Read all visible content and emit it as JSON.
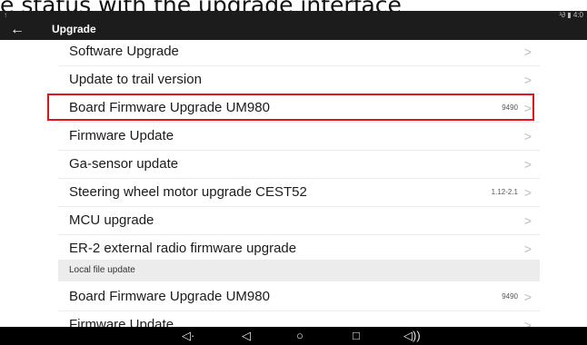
{
  "caption": "e status with the upgrade interface",
  "status_bar": {
    "left": "↑",
    "right": "³∂ ▮ 4:0"
  },
  "app_bar": {
    "back_icon": "arrow-left-icon",
    "title": "Upgrade"
  },
  "rows": [
    {
      "label": "Software Upgrade",
      "value": ""
    },
    {
      "label": "Update to trail version",
      "value": ""
    },
    {
      "label": "Board Firmware Upgrade  UM980",
      "value": "9490"
    },
    {
      "label": "Firmware Update",
      "value": ""
    },
    {
      "label": "Ga-sensor update",
      "value": ""
    },
    {
      "label": "Steering wheel motor upgrade CEST52",
      "value": "1.12-2.1"
    },
    {
      "label": "MCU upgrade",
      "value": ""
    },
    {
      "label": "ER-2 external radio firmware upgrade",
      "value": ""
    }
  ],
  "section_header": "Local file update",
  "local_rows": [
    {
      "label": "Board Firmware Upgrade  UM980",
      "value": "9490"
    },
    {
      "label": "Firmware Update",
      "value": ""
    }
  ],
  "chevron": ">",
  "highlight_color": "#e0141b",
  "nav_bar": {
    "volume_down": "◁·",
    "back": "◁",
    "home": "○",
    "recents": "□",
    "volume_up": "◁))"
  }
}
